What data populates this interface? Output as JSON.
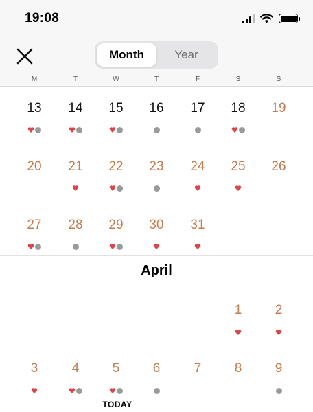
{
  "status_bar": {
    "time": "19:08"
  },
  "nav": {
    "segments": [
      {
        "label": "Month",
        "active": true
      },
      {
        "label": "Year",
        "active": false
      }
    ]
  },
  "weekday_labels": [
    "M",
    "T",
    "W",
    "T",
    "F",
    "S",
    "S"
  ],
  "colors": {
    "weekday_number": "#111111",
    "weekend_or_past": "#c57c4f",
    "heart": "#d9474a",
    "dot": "#9a9a9a"
  },
  "march_rows": [
    [
      {
        "day": "13",
        "color": "black",
        "heart": true,
        "dot": true
      },
      {
        "day": "14",
        "color": "black",
        "heart": true,
        "dot": true
      },
      {
        "day": "15",
        "color": "black",
        "heart": true,
        "dot": true
      },
      {
        "day": "16",
        "color": "black",
        "heart": false,
        "dot": true
      },
      {
        "day": "17",
        "color": "black",
        "heart": false,
        "dot": true
      },
      {
        "day": "18",
        "color": "black",
        "heart": true,
        "dot": true
      },
      {
        "day": "19",
        "color": "orange",
        "heart": false,
        "dot": false
      }
    ],
    [
      {
        "day": "20",
        "color": "orange",
        "heart": false,
        "dot": false
      },
      {
        "day": "21",
        "color": "orange",
        "heart": true,
        "dot": false
      },
      {
        "day": "22",
        "color": "orange",
        "heart": true,
        "dot": true
      },
      {
        "day": "23",
        "color": "orange",
        "heart": false,
        "dot": true
      },
      {
        "day": "24",
        "color": "orange",
        "heart": true,
        "dot": false
      },
      {
        "day": "25",
        "color": "orange",
        "heart": true,
        "dot": false
      },
      {
        "day": "26",
        "color": "orange",
        "heart": false,
        "dot": false
      }
    ],
    [
      {
        "day": "27",
        "color": "orange",
        "heart": true,
        "dot": true
      },
      {
        "day": "28",
        "color": "orange",
        "heart": false,
        "dot": true
      },
      {
        "day": "29",
        "color": "orange",
        "heart": true,
        "dot": true
      },
      {
        "day": "30",
        "color": "orange",
        "heart": true,
        "dot": false
      },
      {
        "day": "31",
        "color": "orange",
        "heart": true,
        "dot": false
      }
    ]
  ],
  "april": {
    "title": "April",
    "rows": [
      [
        null,
        null,
        null,
        null,
        null,
        {
          "day": "1",
          "color": "orange",
          "heart": true,
          "dot": false
        },
        {
          "day": "2",
          "color": "orange",
          "heart": true,
          "dot": false
        }
      ],
      [
        {
          "day": "3",
          "color": "orange",
          "heart": true,
          "dot": false
        },
        {
          "day": "4",
          "color": "orange",
          "heart": true,
          "dot": true
        },
        {
          "day": "5",
          "color": "orange",
          "heart": true,
          "dot": true
        },
        {
          "day": "6",
          "color": "orange",
          "heart": false,
          "dot": true
        },
        {
          "day": "7",
          "color": "orange",
          "heart": false,
          "dot": false
        },
        {
          "day": "8",
          "color": "orange",
          "heart": false,
          "dot": false
        },
        {
          "day": "9",
          "color": "orange",
          "heart": false,
          "dot": true
        }
      ]
    ],
    "today_label": "TODAY"
  }
}
